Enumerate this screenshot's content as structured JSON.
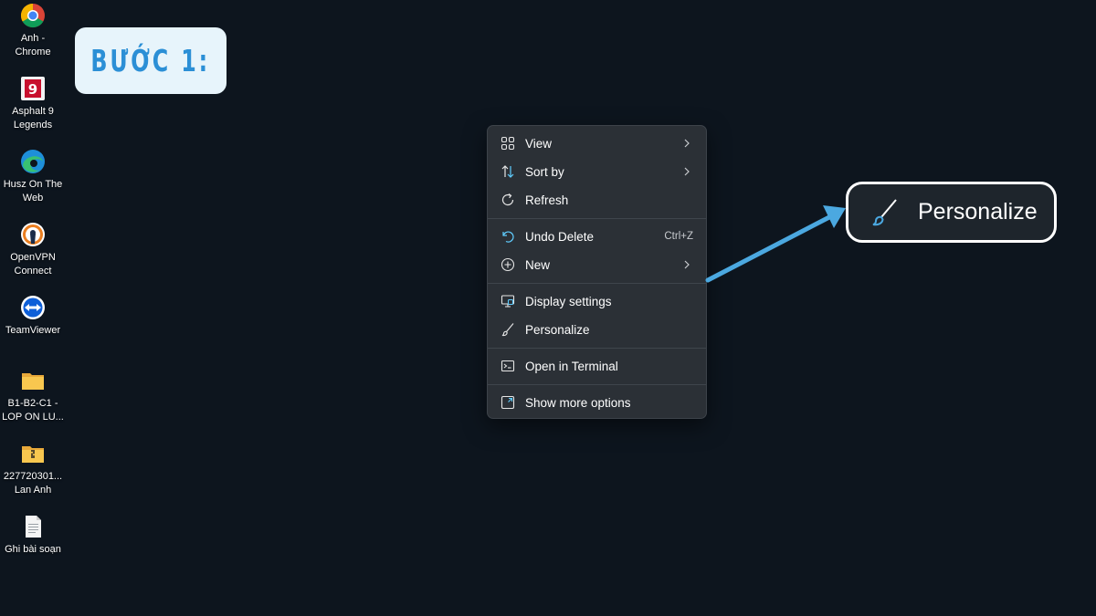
{
  "step_badge": {
    "text": "BƯỚC 1:",
    "color": "#2b8fd6",
    "background": "#e7f4fb"
  },
  "desktop": {
    "background": "#0d151e",
    "icons": [
      {
        "name": "chrome-icon",
        "label": "Anh -\nChrome"
      },
      {
        "name": "asphalt-icon",
        "label": "Asphalt 9\nLegends"
      },
      {
        "name": "edge-icon",
        "label": "Husz On The\nWeb"
      },
      {
        "name": "openvpn-icon",
        "label": "OpenVPN\nConnect"
      },
      {
        "name": "teamviewer-icon",
        "label": "TeamViewer"
      },
      {
        "name": "folder-icon",
        "label": "B1-B2-C1 -\nLOP ON LU..."
      },
      {
        "name": "zip-folder-icon",
        "label": "227720301...\nLan Anh"
      },
      {
        "name": "document-icon",
        "label": "Ghi bài soạn"
      }
    ]
  },
  "context_menu": {
    "items": [
      {
        "label": "View",
        "icon": "grid-icon",
        "submenu": true
      },
      {
        "label": "Sort by",
        "icon": "sort-icon",
        "submenu": true
      },
      {
        "label": "Refresh",
        "icon": "refresh-icon",
        "submenu": false
      },
      {
        "label": "Undo Delete",
        "icon": "undo-icon",
        "shortcut": "Ctrl+Z",
        "submenu": false
      },
      {
        "label": "New",
        "icon": "plus-circle-icon",
        "submenu": true
      },
      {
        "label": "Display settings",
        "icon": "display-icon",
        "submenu": false
      },
      {
        "label": "Personalize",
        "icon": "brush-icon",
        "submenu": false
      },
      {
        "label": "Open in Terminal",
        "icon": "terminal-icon",
        "submenu": false
      },
      {
        "label": "Show more options",
        "icon": "expand-icon",
        "submenu": false
      }
    ]
  },
  "callout": {
    "label": "Personalize",
    "icon": "brush-icon"
  },
  "colors": {
    "accent": "#60cdff",
    "arrow": "#4ba8e0",
    "menu_bg": "#2b3036"
  }
}
